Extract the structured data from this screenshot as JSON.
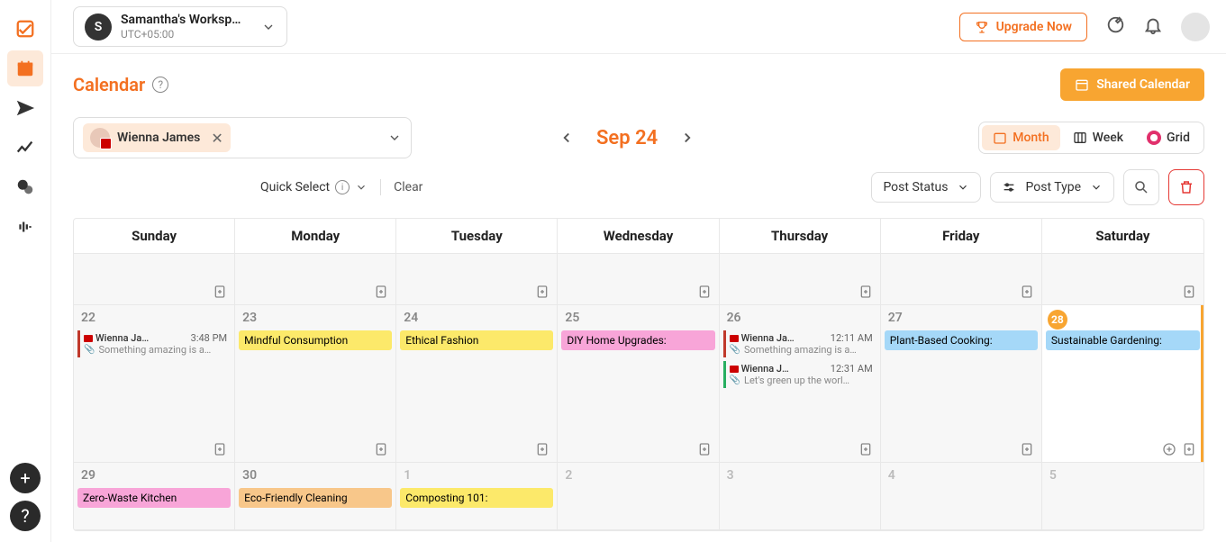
{
  "workspace": {
    "initial": "S",
    "name": "Samantha's Worksp…",
    "tz": "UTC+05:00"
  },
  "topbar": {
    "upgrade": "Upgrade Now"
  },
  "page": {
    "title": "Calendar",
    "shared": "Shared Calendar"
  },
  "profile": {
    "name": "Wienna James"
  },
  "monthNav": {
    "label": "Sep 24"
  },
  "views": {
    "month": "Month",
    "week": "Week",
    "grid": "Grid"
  },
  "quick": {
    "label": "Quick Select",
    "clear": "Clear"
  },
  "filters": {
    "status": "Post Status",
    "type": "Post Type"
  },
  "days": [
    "Sunday",
    "Monday",
    "Tuesday",
    "Wednesday",
    "Thursday",
    "Friday",
    "Saturday"
  ],
  "row2": {
    "sun": {
      "num": "22",
      "post": {
        "name": "Wienna Ja…",
        "time": "3:48 PM",
        "desc": "Something amazing is a…"
      }
    },
    "mon": {
      "num": "23",
      "event": "Mindful Consumption"
    },
    "tue": {
      "num": "24",
      "event": "Ethical Fashion"
    },
    "wed": {
      "num": "25",
      "event": "DIY Home Upgrades:"
    },
    "thu": {
      "num": "26",
      "p1": {
        "name": "Wienna Ja…",
        "time": "12:11 AM",
        "desc": "Something amazing is a…"
      },
      "p2": {
        "name": "Wienna J…",
        "time": "12:31 AM",
        "desc": "Let's green up the worl…"
      }
    },
    "fri": {
      "num": "27",
      "event": "Plant-Based Cooking:"
    },
    "sat": {
      "num": "28",
      "event": "Sustainable Gardening:"
    }
  },
  "row3": {
    "sun": {
      "num": "29",
      "event": "Zero-Waste Kitchen"
    },
    "mon": {
      "num": "30",
      "event": "Eco-Friendly Cleaning"
    },
    "tue": {
      "num": "1",
      "event": "Composting 101:"
    },
    "wed": "2",
    "thu": "3",
    "fri": "4",
    "sat": "5"
  }
}
